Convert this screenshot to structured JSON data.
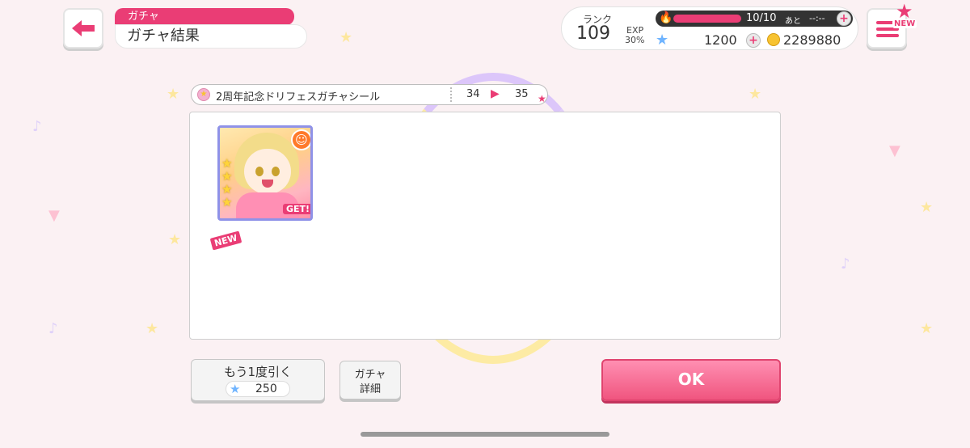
{
  "header": {
    "category": "ガチャ",
    "title": "ガチャ結果"
  },
  "status": {
    "rank_label": "ランク",
    "rank": "109",
    "exp_label": "EXP",
    "exp_percent": "30%",
    "exp_progress": 0.3,
    "stamina": "10/10",
    "stamina_ato": "あと",
    "stamina_time": "--:--",
    "stars": "1200",
    "coins": "2289880",
    "menu_new": "NEW"
  },
  "gacha": {
    "name": "2周年記念ドリフェスガチャシール",
    "count_before": "34",
    "count_after": "35"
  },
  "result": {
    "cards": [
      {
        "badge_new": "NEW",
        "get_label": "GET!",
        "rarity": 4,
        "attribute": "happy",
        "attribute_color": "#ff7a2a"
      }
    ]
  },
  "buttons": {
    "again_label": "もう1度引く",
    "again_cost": "250",
    "detail_line1": "ガチャ",
    "detail_line2": "詳細",
    "ok_label": "OK"
  },
  "colors": {
    "accent": "#ea3d75",
    "background": "#fbf1f3",
    "star_blue": "#6fb4ff"
  }
}
